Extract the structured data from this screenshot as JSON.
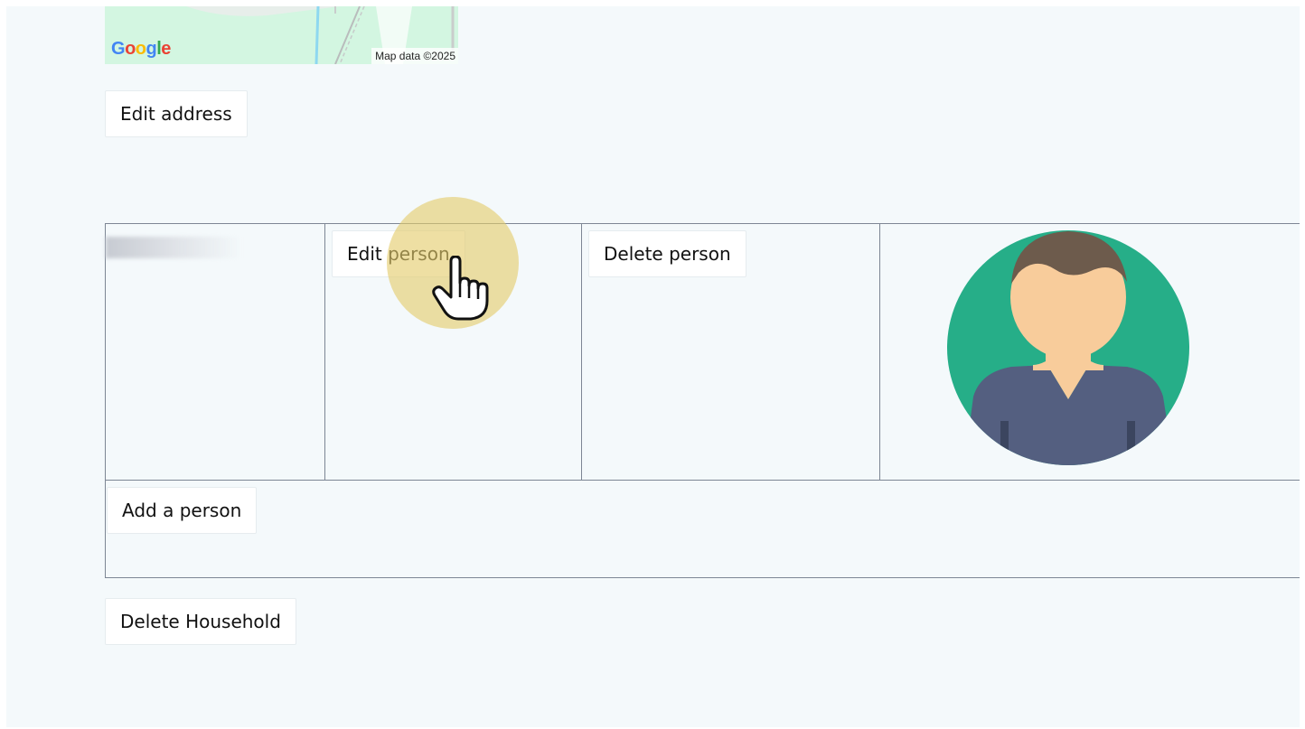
{
  "map": {
    "logo": "Google",
    "credit": "Map data ©2025"
  },
  "address": {
    "edit_label": "Edit address"
  },
  "people": {
    "rows": [
      {
        "edit_label": "Edit person",
        "delete_label": "Delete person",
        "avatar_icon": "person-avatar-icon"
      }
    ],
    "add_label": "Add a person"
  },
  "household": {
    "delete_label": "Delete Household"
  },
  "colors": {
    "page_background": "#f4f9fb",
    "avatar_green": "#26ae88",
    "highlight": "#e4cb6a"
  }
}
